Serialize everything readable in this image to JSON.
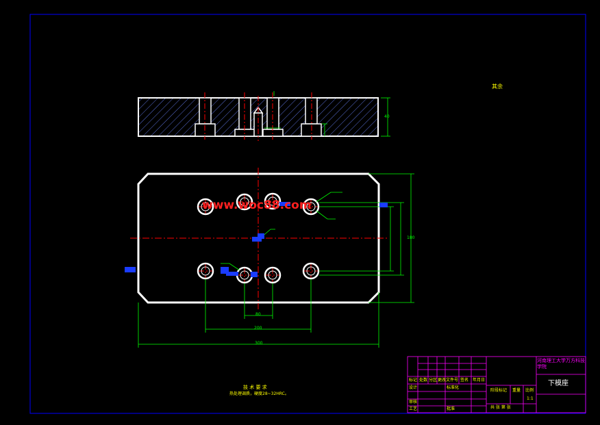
{
  "drawing": {
    "title_block_school": "河南理工大学万方科技学院",
    "part_name": "下模座",
    "scale_note": "比例",
    "roughness_note": "其余",
    "tech_title": "技 术 要 求",
    "tech_text": "热处理调质，硬度28~32HRC。",
    "watermark": "www.woc88.com",
    "dims": {
      "overall_length": "300",
      "hole_span": "200",
      "inner_span": "80",
      "height": "180",
      "thickness": "40"
    },
    "title_block": {
      "row1": [
        "标记",
        "处数",
        "分区",
        "更改文件号",
        "签名",
        "年月日"
      ],
      "design": "设计",
      "standard": "标准化",
      "review": "审核",
      "process": "工艺",
      "approve": "批准",
      "stage_mark": "阶段标记",
      "weight": "重量",
      "ratio": "比例",
      "ratio_val": "1:1",
      "sheet": "共  张  第  张"
    }
  },
  "colors": {
    "frame": "#0000ff",
    "part": "#ffffff",
    "center": "#ff0000",
    "dim": "#00ff00",
    "hatch": "#5a6fd6"
  }
}
